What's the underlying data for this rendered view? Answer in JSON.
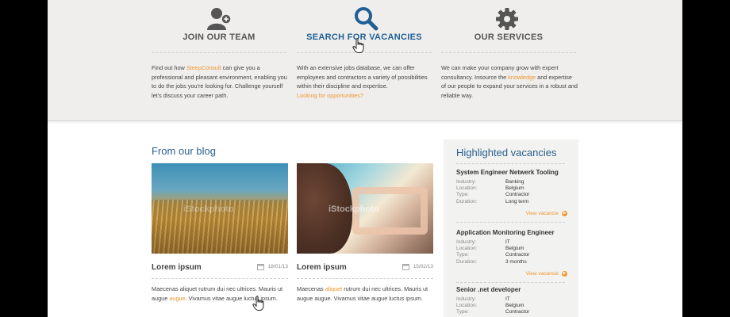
{
  "features": [
    {
      "icon": "user-add-icon",
      "title": "JOIN OUR TEAM",
      "text_before": "Find out how ",
      "highlight": "SteepConsult",
      "text_after": " can give you a professional and pleasant environment, enabling you to do the jobs you're looking for. Challenge yourself let's discuss your career path."
    },
    {
      "icon": "search-icon",
      "title": "SEARCH FOR VACANCIES",
      "text": "With an extensive jobs database, we can offer employees and contractors a variety of possibilities within their discipline and expertise.",
      "link": "Looking for opportunities?"
    },
    {
      "icon": "gear-icon",
      "title": "OUR SERVICES",
      "text_before": "We can make your company grow with expert consultancy. Insource the ",
      "highlight": "knowledge",
      "text_after": " and expertise of our people to expand your services in a robust and reliable way."
    }
  ],
  "blog": {
    "heading": "From our blog",
    "posts": [
      {
        "title": "Lorem ipsum",
        "date": "18/01/13",
        "watermark": "iStockphoto",
        "text_before": "Maecenas aliquet rutrum dui nec ultrices. Mauris ut augue ",
        "highlight": "augue",
        "text_after": ". Vivamus vitae augue luctus ipsum."
      },
      {
        "title": "Lorem ipsum",
        "date": "15/02/13",
        "watermark": "iStockphoto",
        "text_before": "Maecenas ",
        "highlight": "aliquet",
        "text_after": " rutrum dui nec ultrices. Mauris ut augue augue. Vivamus vitae augue luctus ipsum."
      }
    ]
  },
  "vacancies": {
    "heading": "Highlighted vacancies",
    "labels": {
      "industry": "Industry:",
      "location": "Location:",
      "type": "Type:",
      "duration": "Duration:"
    },
    "view_label": "View vacancie",
    "items": [
      {
        "title": "System Engineer Netwerk Tooling",
        "industry": "Banking",
        "location": "Belgium",
        "type": "Contractor",
        "duration": "Long term"
      },
      {
        "title": "Application Monitoring Engineer",
        "industry": "IT",
        "location": "Belgium",
        "type": "Contractor",
        "duration": "3 months"
      },
      {
        "title": "Senior .net developer",
        "industry": "IT",
        "location": "Belgium",
        "type": "Contractor"
      }
    ]
  },
  "colors": {
    "accent": "#f0962e",
    "brand_blue": "#2a5f8f",
    "band_bg": "#efeeec"
  }
}
